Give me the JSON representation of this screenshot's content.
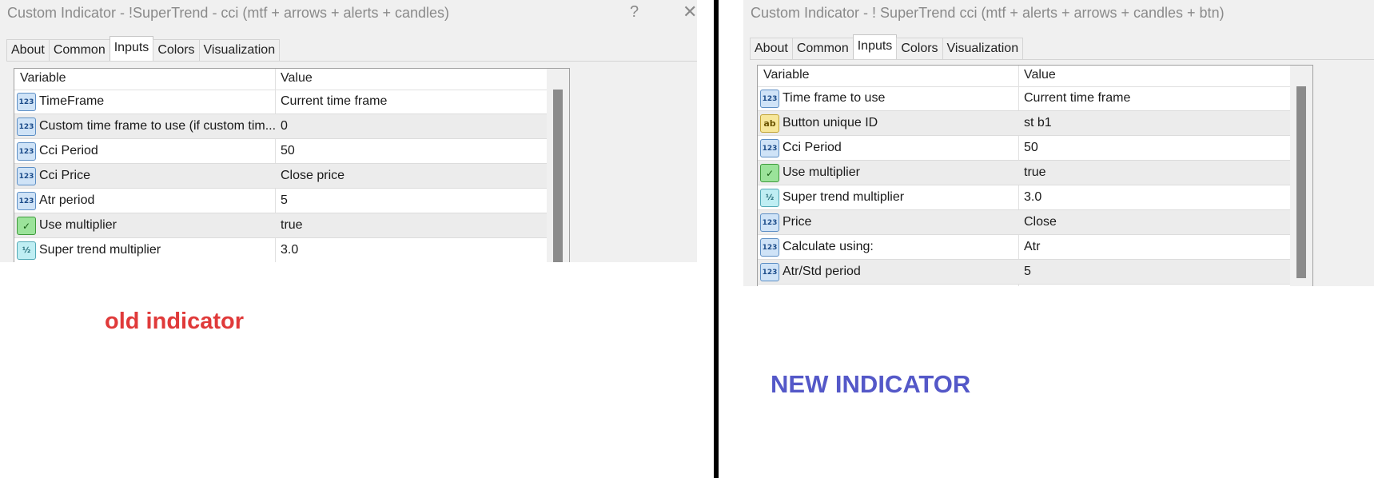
{
  "left_dialog": {
    "title": "Custom Indicator - !SuperTrend - cci (mtf + arrows + alerts + candles)",
    "help_glyph": "?",
    "close_glyph": "✕",
    "tabs": [
      "About",
      "Common",
      "Inputs",
      "Colors",
      "Visualization"
    ],
    "active_tab": "Inputs",
    "columns": {
      "variable": "Variable",
      "value": "Value"
    },
    "rows": [
      {
        "icon": "int-icon",
        "variable": "TimeFrame",
        "value": "Current time frame"
      },
      {
        "icon": "int-icon",
        "variable": "Custom time frame to use (if custom tim...",
        "value": "0"
      },
      {
        "icon": "int-icon",
        "variable": "Cci Period",
        "value": "50"
      },
      {
        "icon": "int-icon",
        "variable": "Cci Price",
        "value": "Close price"
      },
      {
        "icon": "int-icon",
        "variable": "Atr period",
        "value": "5"
      },
      {
        "icon": "bool-icon",
        "variable": "Use multiplier",
        "value": "true"
      },
      {
        "icon": "double-icon",
        "variable": "Super trend multiplier",
        "value": "3.0"
      },
      {
        "icon": "int-icon",
        "variable": "",
        "value": ""
      }
    ]
  },
  "right_dialog": {
    "title": "Custom Indicator - ! SuperTrend cci (mtf + alerts + arrows + candles + btn)",
    "tabs": [
      "About",
      "Common",
      "Inputs",
      "Colors",
      "Visualization"
    ],
    "active_tab": "Inputs",
    "columns": {
      "variable": "Variable",
      "value": "Value"
    },
    "rows": [
      {
        "icon": "int-icon",
        "variable": "Time frame to use",
        "value": "Current time frame"
      },
      {
        "icon": "string-icon",
        "variable": "Button unique ID",
        "value": "st b1"
      },
      {
        "icon": "int-icon",
        "variable": "Cci Period",
        "value": "50"
      },
      {
        "icon": "bool-icon",
        "variable": "Use multiplier",
        "value": "true"
      },
      {
        "icon": "double-icon",
        "variable": "Super trend multiplier",
        "value": "3.0"
      },
      {
        "icon": "int-icon",
        "variable": "Price",
        "value": "Close"
      },
      {
        "icon": "int-icon",
        "variable": "Calculate using:",
        "value": "Atr"
      },
      {
        "icon": "int-icon",
        "variable": "Atr/Std period",
        "value": "5"
      },
      {
        "icon": "string-icon",
        "variable": "",
        "value": ""
      }
    ]
  },
  "captions": {
    "old": "old indicator",
    "new": "NEW INDICATOR"
  },
  "colors": {
    "old_caption": "#e03a3a",
    "new_caption": "#5458c8"
  }
}
